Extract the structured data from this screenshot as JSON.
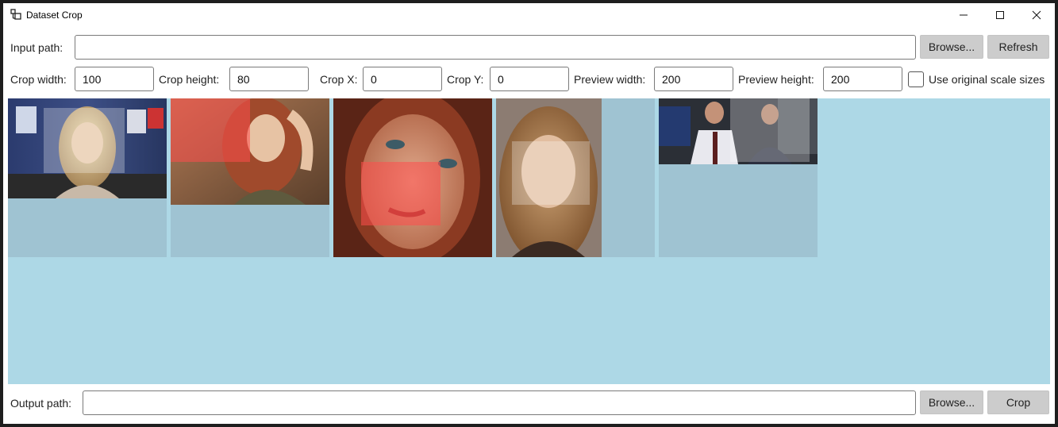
{
  "window": {
    "title": "Dataset Crop"
  },
  "input": {
    "label": "Input path:",
    "value": "",
    "browse_label": "Browse...",
    "refresh_label": "Refresh"
  },
  "params": {
    "crop_width": {
      "label": "Crop width:",
      "value": "100"
    },
    "crop_height": {
      "label": "Crop height:",
      "value": "80"
    },
    "crop_x": {
      "label": "Crop X:",
      "value": "0"
    },
    "crop_y": {
      "label": "Crop Y:",
      "value": "0"
    },
    "preview_width": {
      "label": "Preview width:",
      "value": "200"
    },
    "preview_height": {
      "label": "Preview height:",
      "value": "200"
    },
    "original_scale": {
      "label": "Use original scale sizes",
      "checked": false
    }
  },
  "output": {
    "label": "Output path:",
    "value": "",
    "browse_label": "Browse...",
    "crop_label": "Crop"
  },
  "colors": {
    "gallery_bg": "#add8e6",
    "crop_overlay_red": "#ff4d4d",
    "crop_overlay_white": "#ffffff",
    "button_bg": "#cccccc"
  }
}
